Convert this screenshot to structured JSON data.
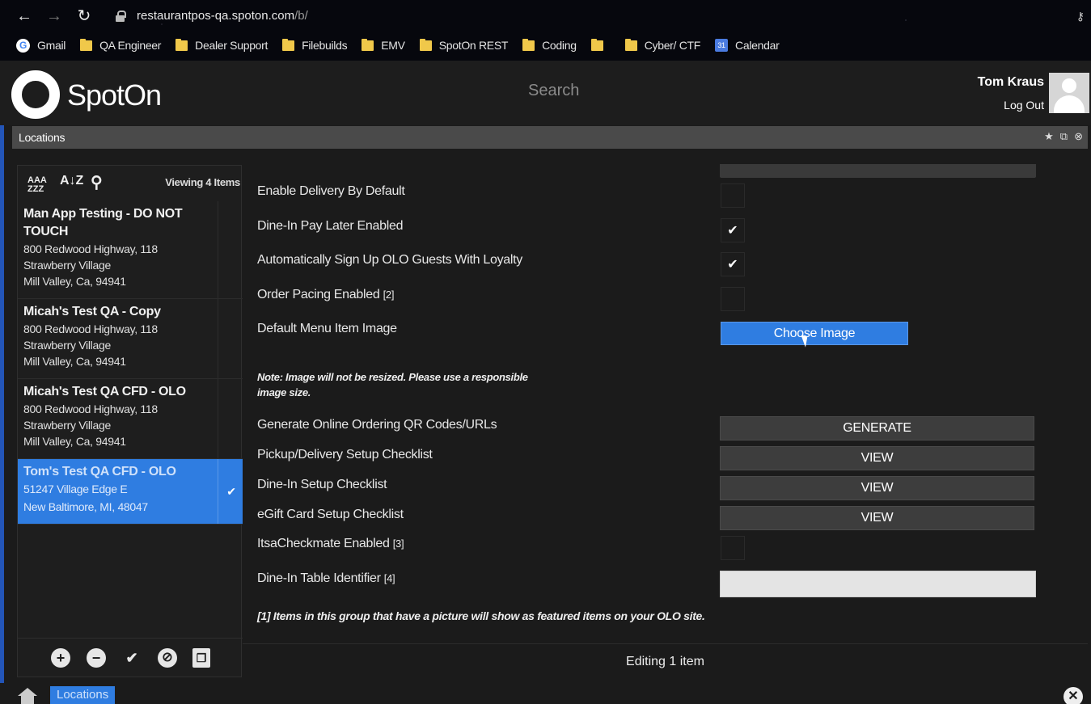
{
  "browser": {
    "url_host": "restaurantpos-qa.spoton.com",
    "url_path": "/b/",
    "bookmarks": [
      "Gmail",
      "QA Engineer",
      "Dealer Support",
      "Filebuilds",
      "EMV",
      "SpotOn REST",
      "Coding",
      "",
      "Cyber/ CTF",
      "Calendar"
    ]
  },
  "header": {
    "logo_text": "SpotOn",
    "search_placeholder": "Search",
    "user_name": "Tom Kraus",
    "logout_label": "Log Out"
  },
  "panel": {
    "title": "Locations"
  },
  "list": {
    "viewing_label": "Viewing 4 Items",
    "items": [
      {
        "name": "Man App Testing - DO NOT TOUCH",
        "addr1": "800 Redwood Highway, 118",
        "addr2": "Strawberry Village",
        "addr3": "Mill Valley, Ca, 94941",
        "selected": false
      },
      {
        "name": "Micah's Test QA - Copy",
        "addr1": "800 Redwood Highway, 118",
        "addr2": "Strawberry Village",
        "addr3": "Mill Valley, Ca, 94941",
        "selected": false
      },
      {
        "name": "Micah's Test QA CFD - OLO",
        "addr1": "800 Redwood Highway, 118",
        "addr2": "Strawberry Village",
        "addr3": "Mill Valley, Ca, 94941",
        "selected": false
      },
      {
        "name": "Tom's Test QA CFD - OLO",
        "addr1": "51247 Village Edge E",
        "addr2": "New Baltimore, MI, 48047",
        "selected": true
      }
    ]
  },
  "form": {
    "enable_delivery": {
      "label": "Enable Delivery By Default",
      "checked": false
    },
    "dine_in_pay_later": {
      "label": "Dine-In Pay Later Enabled",
      "checked": true
    },
    "auto_signup": {
      "label": "Automatically Sign Up OLO Guests With Loyalty",
      "checked": true
    },
    "order_pacing": {
      "label": "Order Pacing Enabled",
      "footnote": "[2]",
      "checked": false
    },
    "default_image": {
      "label": "Default Menu Item Image",
      "button": "Choose Image"
    },
    "image_note": "Note: Image will not be resized. Please use a responsible image size.",
    "generate_qr": {
      "label": "Generate Online Ordering QR Codes/URLs",
      "button": "GENERATE"
    },
    "pickup_checklist": {
      "label": "Pickup/Delivery Setup Checklist",
      "button": "VIEW"
    },
    "dinein_checklist": {
      "label": "Dine-In Setup Checklist",
      "button": "VIEW"
    },
    "egift_checklist": {
      "label": "eGift Card Setup Checklist",
      "button": "VIEW"
    },
    "itsacheckmate": {
      "label": "ItsaCheckmate Enabled",
      "footnote": "[3]",
      "checked": false
    },
    "table_identifier": {
      "label": "Dine-In Table Identifier",
      "footnote": "[4]",
      "value": ""
    },
    "featured_footnote": "[1] Items in this group that have a picture will show as featured items on your OLO site.",
    "editing_label": "Editing 1 item"
  },
  "taskbar": {
    "tab_label": "Locations"
  },
  "colors": {
    "accent": "#2f7de1",
    "panel_bar": "#4a4a4a"
  }
}
